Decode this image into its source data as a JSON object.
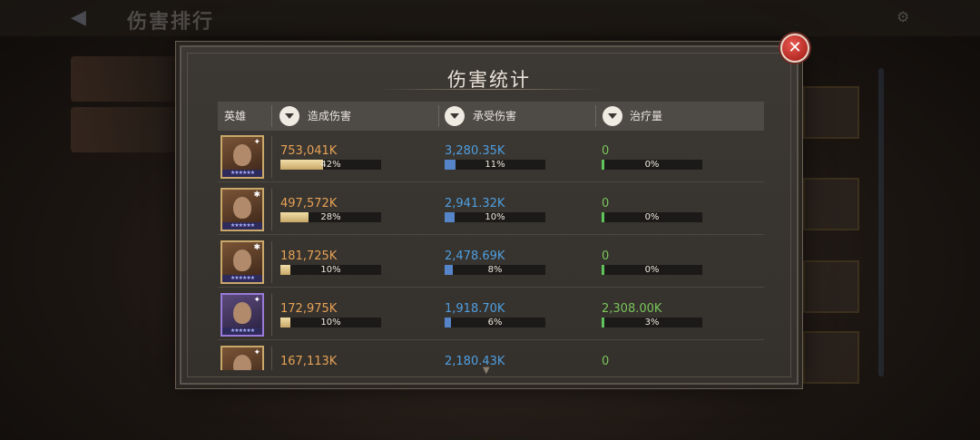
{
  "background": {
    "title": "伤害排行",
    "back_icon": "back-arrow-icon",
    "gear_icon": "gear-icon"
  },
  "dialog": {
    "title": "伤害统计",
    "close_icon": "close-icon"
  },
  "columns": {
    "hero": "英雄",
    "damage_dealt": "造成伤害",
    "damage_taken": "承受伤害",
    "healing": "治疗量"
  },
  "rows": [
    {
      "portrait_icon": "hero-portrait-icon",
      "class_icon": "class-icon",
      "damage": "753,041K",
      "damage_pct": "42%",
      "damage_frac": 0.42,
      "taken": "3,280.35K",
      "taken_pct": "11%",
      "taken_frac": 0.11,
      "heal": "0",
      "heal_pct": "0%",
      "heal_frac": 0.0
    },
    {
      "portrait_icon": "hero-portrait-icon",
      "class_icon": "class-icon",
      "damage": "497,572K",
      "damage_pct": "28%",
      "damage_frac": 0.28,
      "taken": "2,941.32K",
      "taken_pct": "10%",
      "taken_frac": 0.1,
      "heal": "0",
      "heal_pct": "0%",
      "heal_frac": 0.0
    },
    {
      "portrait_icon": "hero-portrait-icon",
      "class_icon": "class-icon",
      "damage": "181,725K",
      "damage_pct": "10%",
      "damage_frac": 0.1,
      "taken": "2,478.69K",
      "taken_pct": "8%",
      "taken_frac": 0.08,
      "heal": "0",
      "heal_pct": "0%",
      "heal_frac": 0.0
    },
    {
      "portrait_icon": "hero-portrait-icon",
      "class_icon": "class-icon",
      "damage": "172,975K",
      "damage_pct": "10%",
      "damage_frac": 0.1,
      "taken": "1,918.70K",
      "taken_pct": "6%",
      "taken_frac": 0.06,
      "heal": "2,308.00K",
      "heal_pct": "3%",
      "heal_frac": 0.03
    },
    {
      "portrait_icon": "hero-portrait-icon",
      "class_icon": "class-icon",
      "damage": "167,113K",
      "damage_pct": "",
      "damage_frac": 0.1,
      "taken": "2,180.43K",
      "taken_pct": "",
      "taken_frac": 0.07,
      "heal": "0",
      "heal_pct": "",
      "heal_frac": 0.0
    }
  ],
  "colors": {
    "damage": "#e7a256",
    "taken": "#4f9fe0",
    "heal": "#79c55b",
    "close": "#c9362e"
  }
}
